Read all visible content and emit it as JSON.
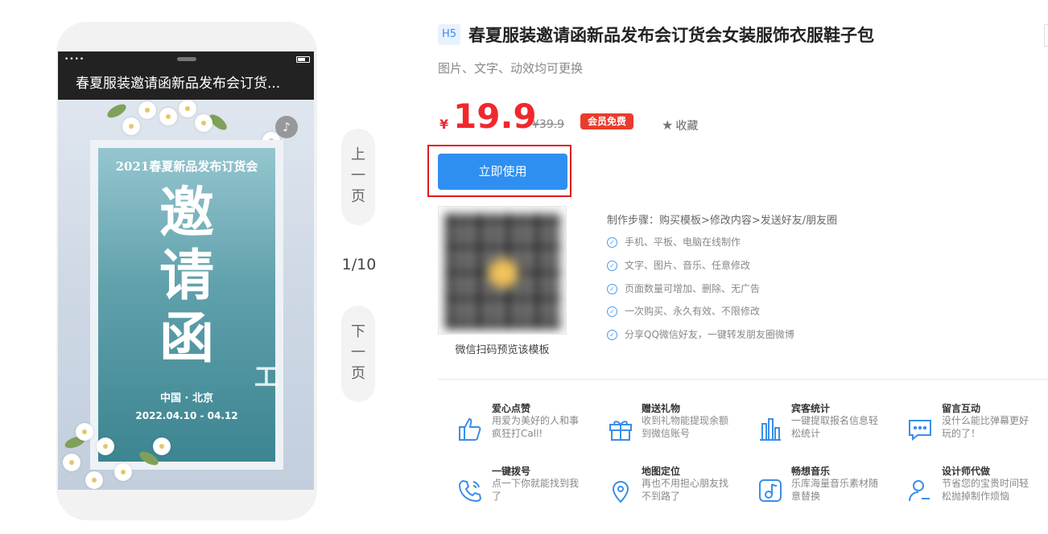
{
  "phone": {
    "title": "春夏服装邀请函新品发布会订货...",
    "card_title": "2021春夏新品发布订货会",
    "big_chars": [
      "邀",
      "请",
      "函"
    ],
    "location": "中国 · 北京",
    "date": "2022.04.10 - 04.12"
  },
  "pager": {
    "prev": "上一页",
    "next": "下一页",
    "page": "1/10"
  },
  "product": {
    "badge": "H5",
    "title": "春夏服装邀请函新品发布会订货会女装服饰衣服鞋子包",
    "subtitle": "图片、文字、动效均可更换",
    "currency": "¥",
    "price": "19.9",
    "old_price": "¥39.9",
    "vip_label": "会员免费",
    "favorite_label": "收藏",
    "use_button": "立即使用"
  },
  "qr": {
    "caption": "微信扫码预览该模板"
  },
  "steps": {
    "title": "制作步骤：购买模板>修改内容>发送好友/朋友圈",
    "items": [
      "手机、平板、电脑在线制作",
      "文字、图片、音乐、任意修改",
      "页面数量可增加、删除、无广告",
      "一次购买、永久有效、不限修改",
      "分享QQ微信好友，一键转发朋友圈微博"
    ]
  },
  "features": [
    {
      "icon": "thumbs-up-icon",
      "title": "爱心点赞",
      "desc": "用爱为美好的人和事疯狂打Call!"
    },
    {
      "icon": "gift-icon",
      "title": "赠送礼物",
      "desc": "收到礼物能提现余额到微信账号"
    },
    {
      "icon": "bar-chart-icon",
      "title": "宾客统计",
      "desc": "一键提取报名信息轻松统计"
    },
    {
      "icon": "message-icon",
      "title": "留言互动",
      "desc": "没什么能比弹幕更好玩的了！"
    },
    {
      "icon": "phone-icon",
      "title": "一键拨号",
      "desc": "点一下你就能找到我了"
    },
    {
      "icon": "map-pin-icon",
      "title": "地图定位",
      "desc": "再也不用担心朋友找不到路了"
    },
    {
      "icon": "music-note-icon",
      "title": "畅想音乐",
      "desc": "乐库海量音乐素材随意替换"
    },
    {
      "icon": "user-icon",
      "title": "设计师代做",
      "desc": "节省您的宝贵时间轻松抛掉制作烦恼"
    }
  ],
  "colors": {
    "accent": "#2f8ff0",
    "price": "#f0282d",
    "highlight": "#e0191f"
  }
}
